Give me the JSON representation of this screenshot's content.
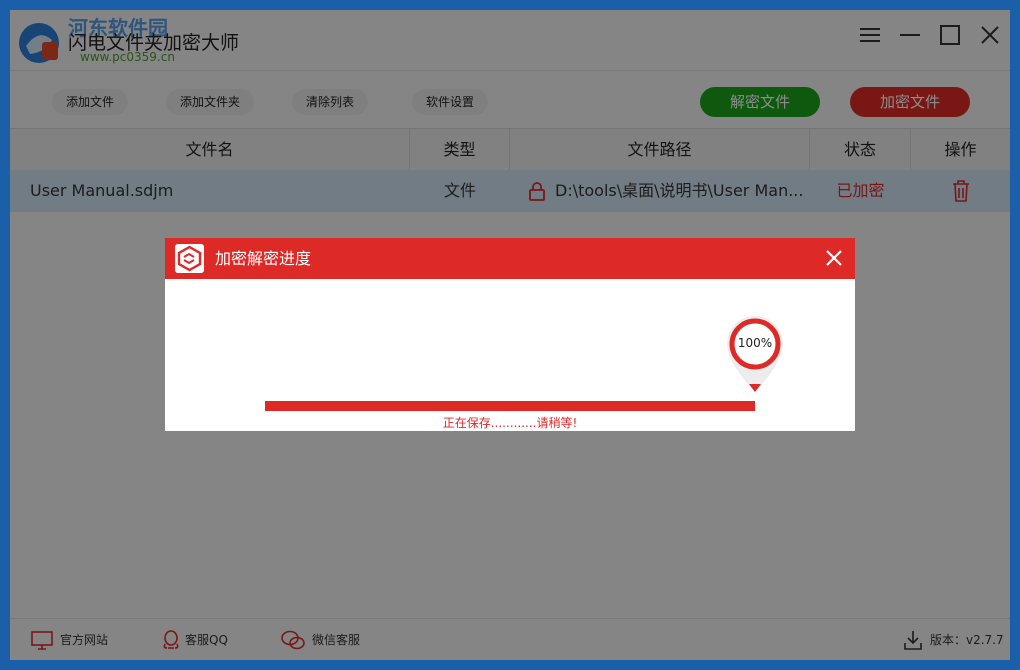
{
  "app": {
    "title": "闪电文件夹加密大师",
    "watermark": "河东软件园",
    "watermark_url": "www.pc0359.cn"
  },
  "toolbar": {
    "add_file": "添加文件",
    "add_folder": "添加文件夹",
    "clear_list": "清除列表",
    "settings": "软件设置",
    "decrypt": "解密文件",
    "encrypt": "加密文件"
  },
  "table": {
    "headers": [
      "文件名",
      "类型",
      "文件路径",
      "状态",
      "操作"
    ],
    "rows": [
      {
        "name": "User Manual.sdjm",
        "type": "文件",
        "path": "D:\\tools\\桌面\\说明书\\User Man...",
        "status": "已加密"
      }
    ]
  },
  "dialog": {
    "title": "加密解密进度",
    "percent_label": "100%",
    "progress": 1.0,
    "status_text": "正在保存............请稍等!"
  },
  "footer": {
    "website": "官方网站",
    "qq": "客服QQ",
    "wechat": "微信客服",
    "version": "版本：v2.7.7"
  },
  "colors": {
    "accent_red": "#dd2a27",
    "decrypt_green": "#1aa31a",
    "row_selected": "#cfe2f3"
  }
}
